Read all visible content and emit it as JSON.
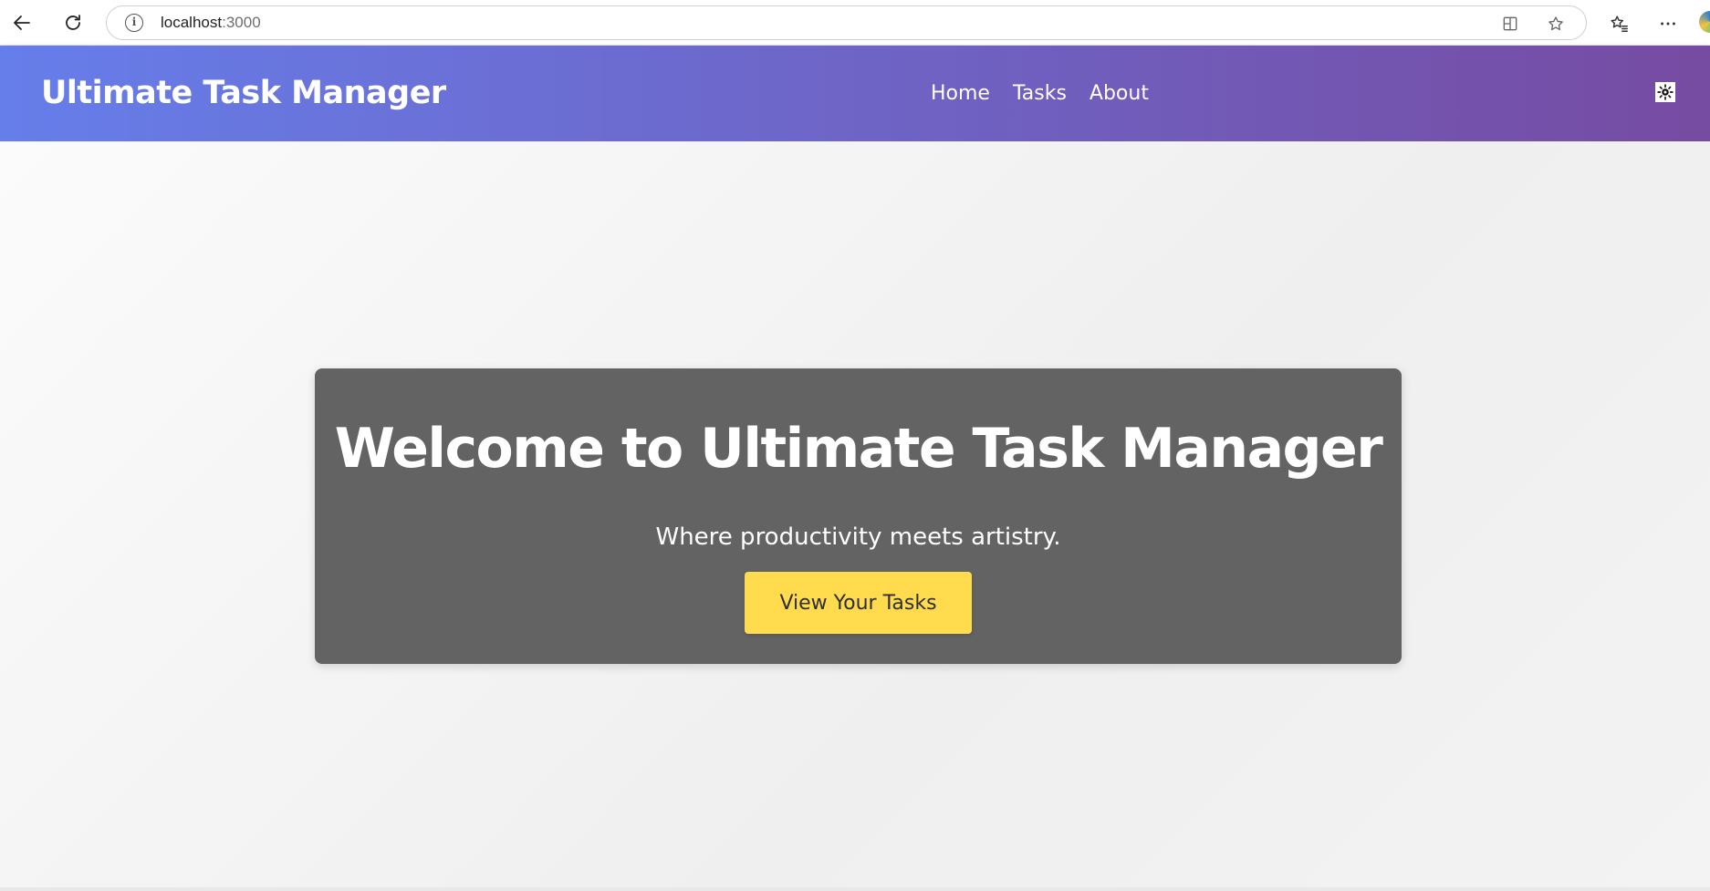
{
  "browser": {
    "url_host": "localhost",
    "url_port": ":3000",
    "icons": {
      "back": "back-arrow-icon",
      "refresh": "refresh-icon",
      "info": "info-icon",
      "split_screen": "split-screen-icon",
      "favorite": "star-icon",
      "favorites_list": "favorites-list-icon",
      "more": "more-horizontal-icon"
    }
  },
  "navbar": {
    "brand": "Ultimate Task Manager",
    "links": [
      "Home",
      "Tasks",
      "About"
    ],
    "theme_toggle_icon": "sun-icon",
    "gradient_start": "#667eea",
    "gradient_end": "#764ba2"
  },
  "hero": {
    "title": "Welcome to Ultimate Task Manager",
    "subtitle": "Where productivity meets artistry.",
    "button_label": "View Your Tasks",
    "card_color": "#636363",
    "button_color": "#ffdb4d"
  }
}
